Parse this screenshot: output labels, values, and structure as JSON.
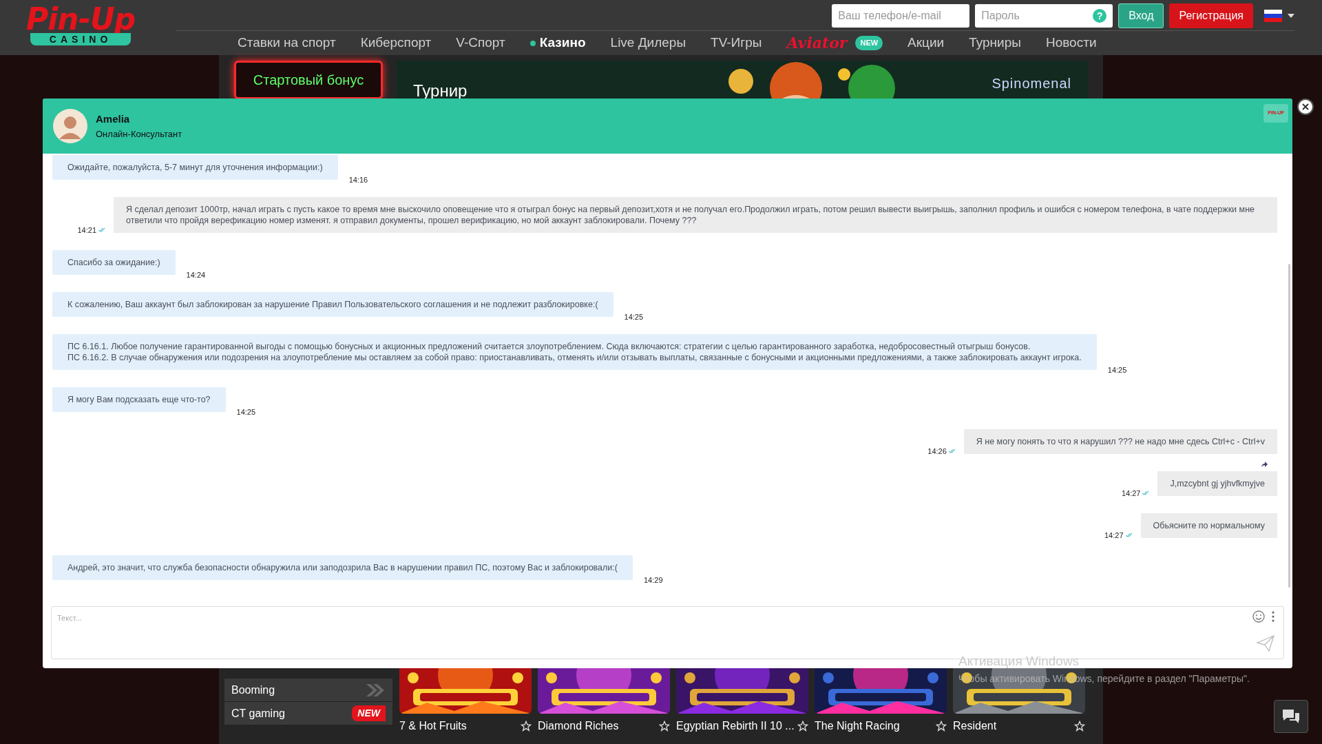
{
  "header": {
    "logo": {
      "text": "Pin-Up",
      "subtext": "CASINO"
    },
    "phone_field": {
      "placeholder": "Ваш телефон/e-mail"
    },
    "password_field": {
      "placeholder": "Пароль"
    },
    "help_icon": "?",
    "login_button": "Вход",
    "register_button": "Регистрация"
  },
  "nav": [
    {
      "label": "Ставки на спорт",
      "selected": false,
      "kind": "link"
    },
    {
      "label": "Киберспорт",
      "selected": false,
      "kind": "link"
    },
    {
      "label": "V-Спорт",
      "selected": false,
      "kind": "link"
    },
    {
      "label": "Казино",
      "selected": true,
      "kind": "link"
    },
    {
      "label": "Live Дилеры",
      "selected": false,
      "kind": "link"
    },
    {
      "label": "TV-Игры",
      "selected": false,
      "kind": "link"
    },
    {
      "label": "Aviator",
      "selected": false,
      "kind": "aviator",
      "badge": "NEW"
    },
    {
      "label": "Акции",
      "selected": false,
      "kind": "link"
    },
    {
      "label": "Турниры",
      "selected": false,
      "kind": "link"
    },
    {
      "label": "Новости",
      "selected": false,
      "kind": "link"
    }
  ],
  "promo": {
    "bonus_button": "Стартовый бонус",
    "banner_title": "Турнир",
    "provider": "Spinomenal"
  },
  "chat": {
    "agent_name": "Amelia",
    "agent_role": "Онлайн-Консультант",
    "brand_mark": "PIN-UP",
    "messages": [
      {
        "kind": "agent",
        "text": "Ожидайте, пожалуйста, 5-7 минут для уточнения информации:)",
        "time": "14:16"
      },
      {
        "kind": "user",
        "text": "Я сделал депозит 1000тр, начал играть с пусть какое то время мне выскочило оповещение что я отыграл бонус на первый депозит,хотя и не получал его.Продолжил играть, потом решил вывести выигрышь, заполнил профиль и ошибся с номером телефона, в чате поддержки мне ответили что пройдя верефикацию номер изменят. я отправил документы, прошел верификацию, но мой аккаунт заблокировали. Почему ???",
        "time": "14:21",
        "read": true,
        "forwarded": false
      },
      {
        "kind": "agent",
        "text": "Спасибо за ожидание:)",
        "time": "14:24"
      },
      {
        "kind": "agent",
        "text": "К сожалению, Ваш аккаунт был заблокирован за нарушение Правил Пользовательского соглашения и не подлежит разблокировке:(",
        "time": "14:25"
      },
      {
        "kind": "agent",
        "text": "ПС 6.16.1. Любое получение гарантированной выгоды с помощью бонусных и акционных предложений считается злоупотреблением. Сюда включаются: стратегии с целью гарантированного заработка, недобросовестный отыгрыш бонусов.\nПС 6.16.2. В случае обнаружения или подозрения на злоупотребление мы оставляем за собой право: приостанавливать, отменять и/или отзывать выплаты, связанные с бонусными и акционными предложениями, а также заблокировать аккаунт игрока.",
        "time": "14:25"
      },
      {
        "kind": "agent",
        "text": "Я могу Вам подсказать еще что-то?",
        "time": "14:25"
      },
      {
        "kind": "user",
        "text": "Я не могу понять то что я нарушил ??? не надо мне сдесь Ctrl+c - Ctrl+v",
        "time": "14:26",
        "read": true,
        "forwarded": false
      },
      {
        "kind": "user",
        "text": "J,mzcybnt gj yjhvfkmyjve",
        "time": "14:27",
        "read": true,
        "forwarded": true
      },
      {
        "kind": "user",
        "text": "Обьясните по нормальному",
        "time": "14:27",
        "read": true,
        "forwarded": false
      },
      {
        "kind": "agent",
        "text": "Андрей, это значит, что служба безопасности обнаружила или заподозрила Вас в нарушении правил ПС, поэтому Вас и заблокировали:(",
        "time": "14:29"
      }
    ],
    "input": {
      "placeholder": "Текст..."
    }
  },
  "providers": [
    {
      "name": "Booming"
    },
    {
      "name": "CT gaming",
      "badge": "NEW"
    }
  ],
  "games": [
    {
      "title": "7 & Hot Fruits"
    },
    {
      "title": "Diamond Riches"
    },
    {
      "title": "Egyptian Rebirth II 10 ..."
    },
    {
      "title": "The Night Racing"
    },
    {
      "title": "Resident"
    }
  ],
  "os_notice": {
    "title": "Активация Windows",
    "text": "Чтобы активировать Windows, перейдите в раздел \"Параметры\"."
  }
}
